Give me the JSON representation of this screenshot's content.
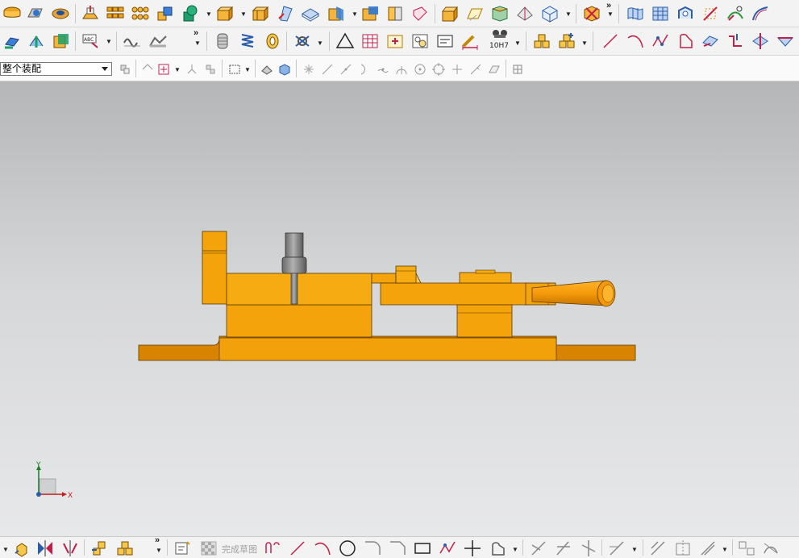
{
  "selection_filter": {
    "value": "整个装配"
  },
  "sketch_toolbar": {
    "finish_sketch_label": "完成草图"
  },
  "tolerance_icon_text": "10H7",
  "label_abc": "ABC",
  "triad": {
    "x_label": "X",
    "y_label": "Y"
  },
  "colors": {
    "part_orange": "#f5a30a",
    "part_dark": "#d98500",
    "shaft_gray": "#8a8a8a",
    "background_top": "#b5b6b8",
    "background_bottom": "#e7e8ea"
  }
}
